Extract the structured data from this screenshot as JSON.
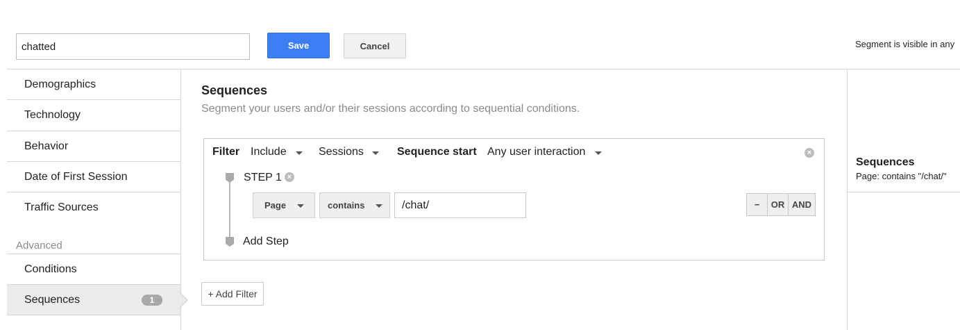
{
  "header": {
    "segment_name": "chatted",
    "save_label": "Save",
    "cancel_label": "Cancel",
    "visibility_text": "Segment is visible in any"
  },
  "sidebar": {
    "items": [
      {
        "label": "Demographics"
      },
      {
        "label": "Technology"
      },
      {
        "label": "Behavior"
      },
      {
        "label": "Date of First Session"
      },
      {
        "label": "Traffic Sources"
      }
    ],
    "advanced_heading": "Advanced",
    "advanced_items": [
      {
        "label": "Conditions"
      },
      {
        "label": "Sequences",
        "badge": "1",
        "active": true
      }
    ]
  },
  "main": {
    "title": "Sequences",
    "subtitle": "Segment your users and/or their sessions according to sequential conditions.",
    "filter": {
      "filter_label": "Filter",
      "include_value": "Include",
      "scope_value": "Sessions",
      "sequence_start_label": "Sequence start",
      "sequence_start_value": "Any user interaction",
      "step_label": "STEP 1",
      "dimension_value": "Page",
      "operator_value": "contains",
      "match_value": "/chat/",
      "remove_label": "−",
      "or_label": "OR",
      "and_label": "AND",
      "add_step_label": "Add Step"
    },
    "add_filter_label": "+ Add Filter"
  },
  "summary": {
    "title": "Sequences",
    "detail": "Page: contains \"/chat/\""
  },
  "colors": {
    "save_button": "#3d7ef5",
    "border": "#d6d6d6",
    "active_item": "#ebebeb"
  }
}
